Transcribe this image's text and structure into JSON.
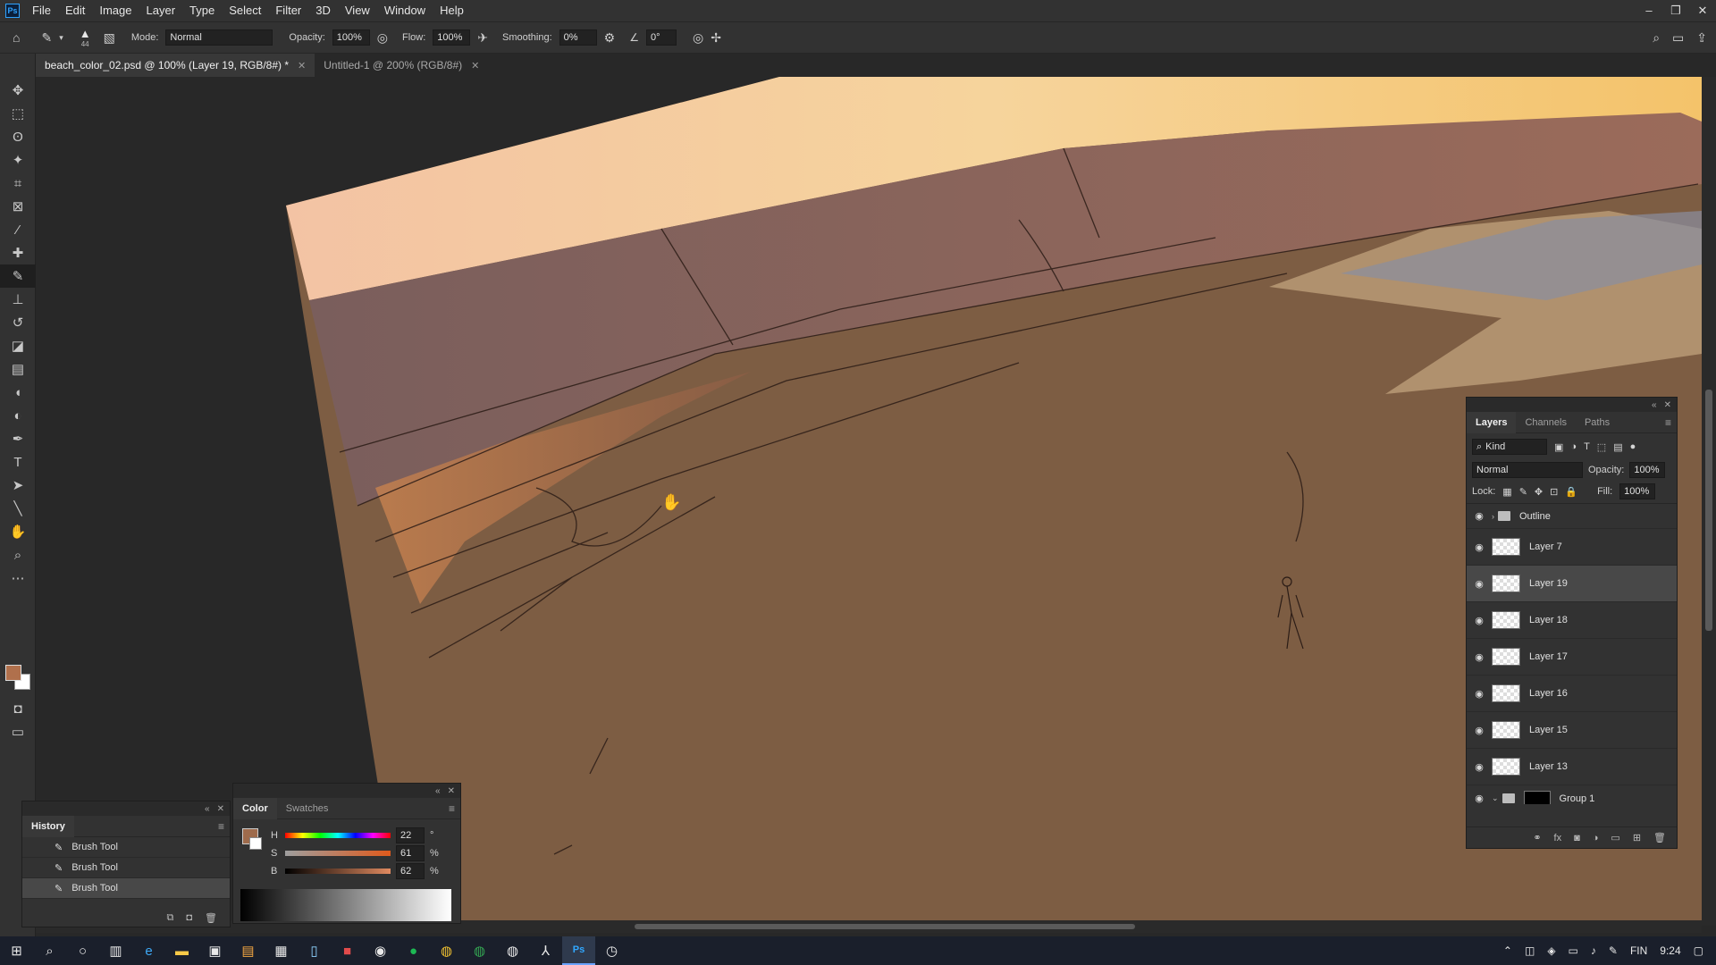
{
  "app": {
    "logo": "Ps"
  },
  "menu": [
    "File",
    "Edit",
    "Image",
    "Layer",
    "Type",
    "Select",
    "Filter",
    "3D",
    "View",
    "Window",
    "Help"
  ],
  "window_controls": {
    "minimize": "–",
    "restore": "❐",
    "close": "✕"
  },
  "options_bar": {
    "brush_size": "44",
    "mode_label": "Mode:",
    "mode_value": "Normal",
    "opacity_label": "Opacity:",
    "opacity_value": "100%",
    "flow_label": "Flow:",
    "flow_value": "100%",
    "smoothing_label": "Smoothing:",
    "smoothing_value": "0%",
    "angle_value": "0°"
  },
  "tabs": [
    {
      "label": "beach_color_02.psd @ 100% (Layer 19, RGB/8#) *",
      "active": true
    },
    {
      "label": "Untitled-1 @ 200% (RGB/8#)",
      "active": false
    }
  ],
  "tools": [
    "move-icon",
    "marquee-icon",
    "lasso-icon",
    "magic-wand-icon",
    "crop-icon",
    "frame-icon",
    "eyedropper-icon",
    "healing-icon",
    "brush-icon",
    "stamp-icon",
    "history-brush-icon",
    "eraser-icon",
    "gradient-icon",
    "blur-icon",
    "dodge-icon",
    "pen-icon",
    "type-icon",
    "path-select-icon",
    "line-icon",
    "hand-icon",
    "zoom-icon",
    "more-icon"
  ],
  "colors": {
    "foreground": "#b0704c",
    "background": "#ffffff"
  },
  "layers_panel": {
    "tabs": [
      "Layers",
      "Channels",
      "Paths"
    ],
    "kind_label": "Kind",
    "blend_mode": "Normal",
    "opacity_label": "Opacity:",
    "opacity_value": "100%",
    "lock_label": "Lock:",
    "fill_label": "Fill:",
    "fill_value": "100%",
    "layers": [
      {
        "name": "Outline",
        "type": "group"
      },
      {
        "name": "Layer 7",
        "type": "layer"
      },
      {
        "name": "Layer 19",
        "type": "layer",
        "selected": true
      },
      {
        "name": "Layer 18",
        "type": "layer"
      },
      {
        "name": "Layer 17",
        "type": "layer"
      },
      {
        "name": "Layer 16",
        "type": "layer"
      },
      {
        "name": "Layer 15",
        "type": "layer"
      },
      {
        "name": "Layer 13",
        "type": "layer"
      },
      {
        "name": "Group 1",
        "type": "group"
      }
    ]
  },
  "history_panel": {
    "title": "History",
    "items": [
      "Brush Tool",
      "Brush Tool",
      "Brush Tool"
    ]
  },
  "color_panel": {
    "tabs": [
      "Color",
      "Swatches"
    ],
    "h_label": "H",
    "h_value": "22",
    "h_unit": "°",
    "s_label": "S",
    "s_value": "61",
    "s_unit": "%",
    "b_label": "B",
    "b_value": "62",
    "b_unit": "%",
    "swatch_color": "#9e6b4c"
  },
  "taskbar": {
    "apps": [
      "start-icon",
      "search-icon",
      "cortana-icon",
      "task-view-icon",
      "edge-icon",
      "explorer-icon",
      "store-icon",
      "app-icon",
      "calculator-icon",
      "notepad-icon",
      "app-red-icon",
      "app-ie-icon",
      "spotify-icon",
      "chrome-icon",
      "chrome-icon-2",
      "chrome-icon-3",
      "acrobat-icon",
      "photoshop-icon",
      "clock-icon"
    ],
    "language": "FIN",
    "time": "9:24"
  }
}
